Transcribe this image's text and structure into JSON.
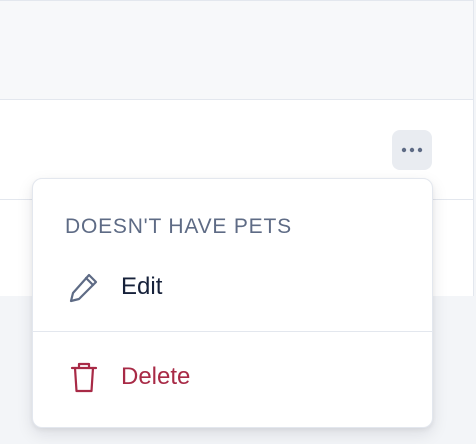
{
  "menu": {
    "heading": "DOESN'T HAVE PETS",
    "items": [
      {
        "label": "Edit",
        "icon": "pencil-icon"
      },
      {
        "label": "Delete",
        "icon": "trash-icon"
      }
    ]
  },
  "more_button": {
    "icon": "more-horizontal-icon"
  },
  "colors": {
    "heading": "#5e6b85",
    "edit_text": "#16213a",
    "delete_text": "#a82a46",
    "button_bg": "#e9ecf1"
  }
}
